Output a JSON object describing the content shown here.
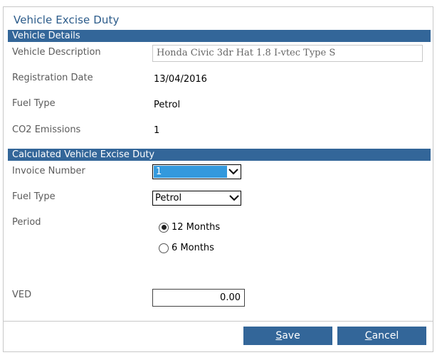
{
  "dialog": {
    "title": "Vehicle Excise Duty"
  },
  "vehicle_details": {
    "header": "Vehicle Details",
    "description_label": "Vehicle Description",
    "description_value": "Honda Civic 3dr Hat 1.8 I-vtec Type S",
    "registration_label": "Registration Date",
    "registration_value": "13/04/2016",
    "fuel_label": "Fuel Type",
    "fuel_value": "Petrol",
    "co2_label": "CO2 Emissions",
    "co2_value": "1"
  },
  "calculated": {
    "header": "Calculated Vehicle Excise Duty",
    "invoice_label": "Invoice Number",
    "invoice_value": "1",
    "fuel_label": "Fuel Type",
    "fuel_value": "Petrol",
    "period_label": "Period",
    "period_options": [
      "12 Months",
      "6 Months"
    ],
    "period_selected": "12 Months",
    "ved_label": "VED",
    "ved_value": "0.00"
  },
  "buttons": {
    "save_first": "S",
    "save_rest": "ave",
    "cancel_first": "C",
    "cancel_rest": "ancel"
  },
  "colors": {
    "accent": "#336699",
    "title": "#2b5b8a",
    "highlight": "#3399dd"
  }
}
